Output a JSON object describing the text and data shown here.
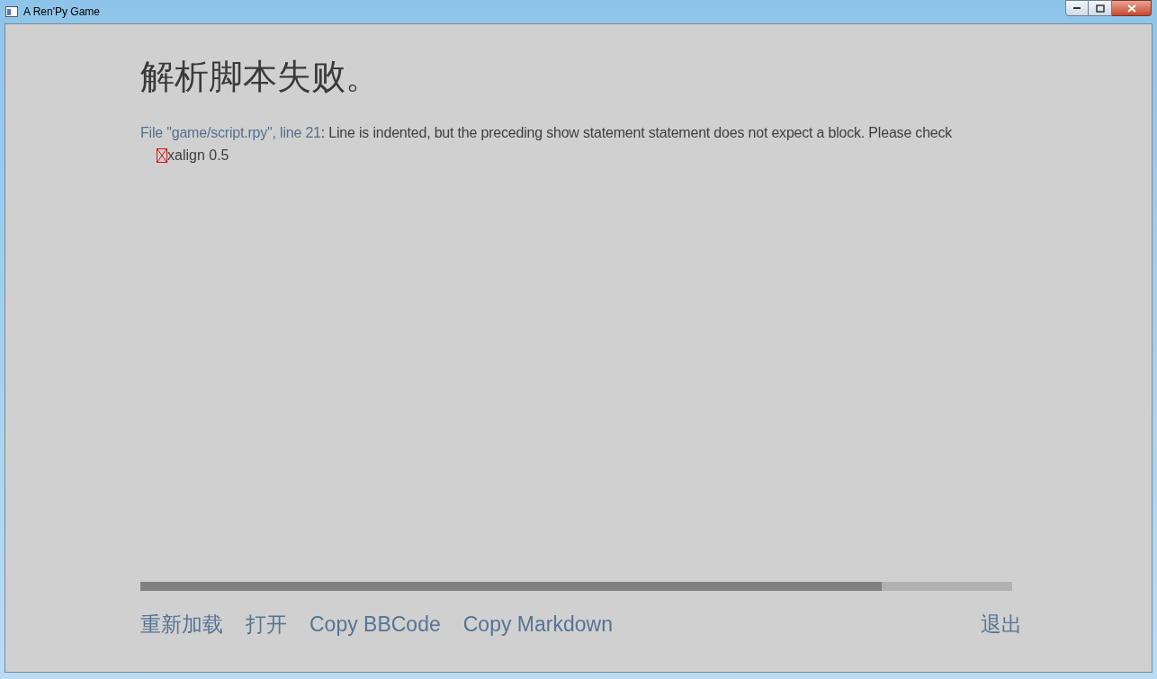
{
  "window": {
    "title": "A Ren'Py Game"
  },
  "heading": "解析脚本失败。",
  "error": {
    "location": "File \"game/script.rpy\", line 21",
    "message": ": Line is indented, but the preceding show statement statement does not expect a block. Please check",
    "code": "xalign 0.5"
  },
  "actions": [
    "重新加载",
    "打开",
    "Copy BBCode",
    "Copy Markdown"
  ],
  "quit": "退出"
}
